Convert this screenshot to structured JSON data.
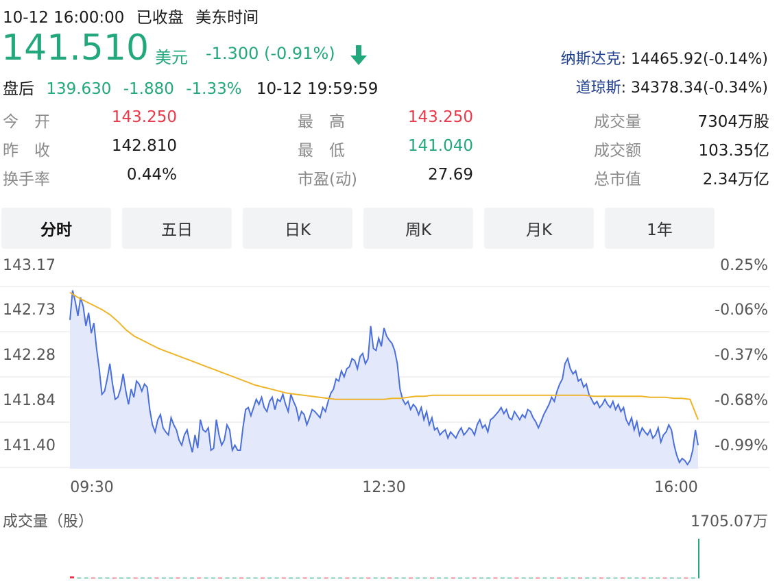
{
  "header": {
    "date": "10-12 16:00:00",
    "status": "已收盘",
    "timezone": "美东时间"
  },
  "quote": {
    "price": "141.510",
    "currency": "美元",
    "change": "-1.300 (-0.91%)",
    "trend_icon": "down-arrow-icon"
  },
  "after_hours": {
    "label": "盘后",
    "price": "139.630",
    "change": "-1.880",
    "pct": "-1.33%",
    "time": "10-12 19:59:59"
  },
  "indices": [
    {
      "name": "纳斯达克",
      "sep": ":",
      "value": " 14465.92(-0.14%)"
    },
    {
      "name": "道琼斯",
      "sep": ":",
      "value": " 34378.34(-0.34%)"
    }
  ],
  "stats": [
    {
      "label": "今　开",
      "value": "143.250",
      "color": "#e8394a"
    },
    {
      "label": "最　高",
      "value": "143.250",
      "color": "#e8394a"
    },
    {
      "label": "成交量",
      "value": "7304万股",
      "color": "#1a1a1a"
    },
    {
      "label": "昨　收",
      "value": "142.810",
      "color": "#1a1a1a"
    },
    {
      "label": "最　低",
      "value": "141.040",
      "color": "#23a87d"
    },
    {
      "label": "成交额",
      "value": "103.35亿",
      "color": "#1a1a1a"
    },
    {
      "label": "换手率",
      "value": "0.44%",
      "color": "#1a1a1a"
    },
    {
      "label": "市盈(动)",
      "value": "27.69",
      "color": "#1a1a1a"
    },
    {
      "label": "总市值",
      "value": "2.34万亿",
      "color": "#1a1a1a"
    }
  ],
  "tabs": [
    {
      "label": "分时",
      "active": true
    },
    {
      "label": "五日",
      "active": false
    },
    {
      "label": "日K",
      "active": false
    },
    {
      "label": "周K",
      "active": false
    },
    {
      "label": "月K",
      "active": false
    },
    {
      "label": "1年",
      "active": false
    }
  ],
  "chart_data": {
    "type": "line",
    "y_ticks_left": [
      "143.17",
      "142.73",
      "142.28",
      "141.84",
      "141.40"
    ],
    "y_ticks_right": [
      "0.25%",
      "-0.06%",
      "-0.37%",
      "-0.68%",
      "-0.99%"
    ],
    "x_ticks": [
      "09:30",
      "12:30",
      "16:00"
    ],
    "ylim": [
      141.22,
      143.22
    ],
    "grid": true,
    "colors": {
      "price": "#4a6fdc",
      "avg": "#f0b429",
      "fill": "#dfe5fa",
      "vol_up": "#e8394a",
      "vol_down": "#23a87d"
    },
    "series": [
      {
        "values": [
          142.68,
          142.97,
          142.86,
          142.72,
          142.9,
          142.81,
          142.62,
          142.75,
          142.55,
          142.65,
          142.4,
          142.2,
          141.95,
          141.98,
          142.1,
          142.25,
          142.05,
          141.9,
          141.92,
          142.0,
          142.15,
          141.98,
          141.85,
          142.0,
          141.92,
          142.08,
          142.05,
          141.98,
          142.05,
          142.02,
          141.8,
          141.65,
          141.58,
          141.7,
          141.75,
          141.62,
          141.58,
          141.55,
          141.72,
          141.65,
          141.6,
          141.5,
          141.45,
          141.55,
          141.6,
          141.48,
          141.38,
          141.55,
          141.42,
          141.7,
          141.6,
          141.58,
          141.62,
          141.4,
          141.42,
          141.7,
          141.55,
          141.45,
          141.5,
          141.65,
          141.6,
          141.4,
          141.45,
          141.4,
          141.4,
          141.62,
          141.8,
          141.82,
          141.74,
          141.82,
          141.9,
          141.85,
          141.92,
          141.82,
          141.78,
          141.88,
          141.92,
          141.8,
          141.9,
          141.88,
          141.95,
          141.85,
          141.78,
          141.95,
          141.88,
          141.82,
          141.7,
          141.78,
          141.75,
          141.65,
          141.72,
          141.8,
          141.78,
          141.75,
          141.72,
          141.82,
          141.78,
          141.88,
          141.96,
          142.0,
          142.1,
          142.08,
          142.18,
          142.12,
          142.2,
          142.22,
          142.3,
          142.28,
          142.2,
          142.32,
          142.35,
          142.25,
          142.3,
          142.62,
          142.4,
          142.38,
          142.5,
          142.42,
          142.6,
          142.52,
          142.48,
          142.45,
          142.38,
          142.25,
          142.0,
          141.9,
          141.85,
          141.88,
          141.8,
          141.85,
          141.82,
          141.75,
          141.82,
          141.7,
          141.78,
          141.65,
          141.72,
          141.6,
          141.62,
          141.55,
          141.58,
          141.6,
          141.52,
          141.58,
          141.55,
          141.52,
          141.58,
          141.62,
          141.55,
          141.58,
          141.62,
          141.6,
          141.55,
          141.65,
          141.7,
          141.62,
          141.65,
          141.58,
          141.7,
          141.72,
          141.75,
          141.78,
          141.82,
          141.76,
          141.8,
          141.72,
          141.7,
          141.78,
          141.74,
          141.7,
          141.75,
          141.72,
          141.8,
          141.78,
          141.72,
          141.68,
          141.62,
          141.68,
          141.75,
          141.8,
          141.85,
          141.92,
          141.88,
          141.98,
          142.05,
          142.1,
          142.25,
          142.3,
          142.2,
          142.15,
          142.18,
          142.08,
          142.1,
          142.02,
          142.05,
          141.95,
          141.9,
          141.85,
          141.88,
          141.82,
          141.85,
          141.9,
          141.85,
          141.82,
          141.88,
          141.8,
          141.85,
          141.78,
          141.82,
          141.7,
          141.65,
          141.72,
          141.6,
          141.68,
          141.55,
          141.62,
          141.58,
          141.55,
          141.6,
          141.52,
          141.55,
          141.62,
          141.48,
          141.55,
          141.58,
          141.65,
          141.6,
          141.45,
          141.35,
          141.28,
          141.32,
          141.3,
          141.26,
          141.3,
          141.4,
          141.6,
          141.45
        ],
        "avg_values": [
          142.95,
          142.9,
          142.86,
          142.82,
          142.78,
          142.73,
          142.66,
          142.58,
          142.52,
          142.48,
          142.44,
          142.4,
          142.37,
          142.34,
          142.31,
          142.28,
          142.25,
          142.22,
          142.19,
          142.16,
          142.13,
          142.1,
          142.07,
          142.04,
          142.02,
          142.0,
          141.98,
          141.96,
          141.95,
          141.94,
          141.93,
          141.92,
          141.91,
          141.9,
          141.9,
          141.9,
          141.9,
          141.9,
          141.9,
          141.9,
          141.91,
          141.91,
          141.92,
          141.93,
          141.93,
          141.94,
          141.94,
          141.94,
          141.94,
          141.94,
          141.94,
          141.94,
          141.94,
          141.94,
          141.94,
          141.94,
          141.94,
          141.94,
          141.94,
          141.94,
          141.94,
          141.94,
          141.94,
          141.94,
          141.94,
          141.93,
          141.93,
          141.93,
          141.93,
          141.93,
          141.93,
          141.93,
          141.92,
          141.92,
          141.92,
          141.91,
          141.91,
          141.9,
          141.7
        ]
      }
    ],
    "volume": {
      "label": "成交量（股）",
      "max_label": "1705.07万",
      "bars": [
        0.05,
        0.02,
        0.02,
        0.02,
        0.02,
        0.02,
        0.02,
        0.02,
        0.02,
        0.02,
        0.02,
        0.02,
        0.02,
        0.02,
        0.02,
        0.02,
        0.02,
        0.02,
        0.02,
        0.02,
        0.02,
        0.02,
        0.02,
        0.02,
        0.02,
        0.02,
        0.02,
        0.02,
        0.02,
        0.02,
        0.02,
        0.02,
        0.02,
        0.02,
        0.02,
        0.02,
        0.02,
        0.02,
        0.02,
        0.02,
        0.02,
        0.02,
        0.02,
        0.02,
        0.02,
        0.02,
        0.02,
        0.02,
        0.02,
        0.02,
        0.02,
        0.02,
        0.02,
        0.02,
        0.02,
        0.02,
        0.02,
        0.02,
        0.02,
        0.02,
        0.02,
        0.02,
        0.02,
        0.02,
        0.02,
        0.02,
        0.02,
        0.02,
        0.02,
        0.02,
        0.02,
        0.02,
        0.02,
        0.02,
        0.02,
        0.02,
        0.02,
        0.02,
        0.02,
        0.02,
        0.02,
        0.02,
        0.02,
        0.02,
        0.02,
        0.02,
        0.02,
        0.02,
        0.02,
        1.0
      ]
    }
  }
}
